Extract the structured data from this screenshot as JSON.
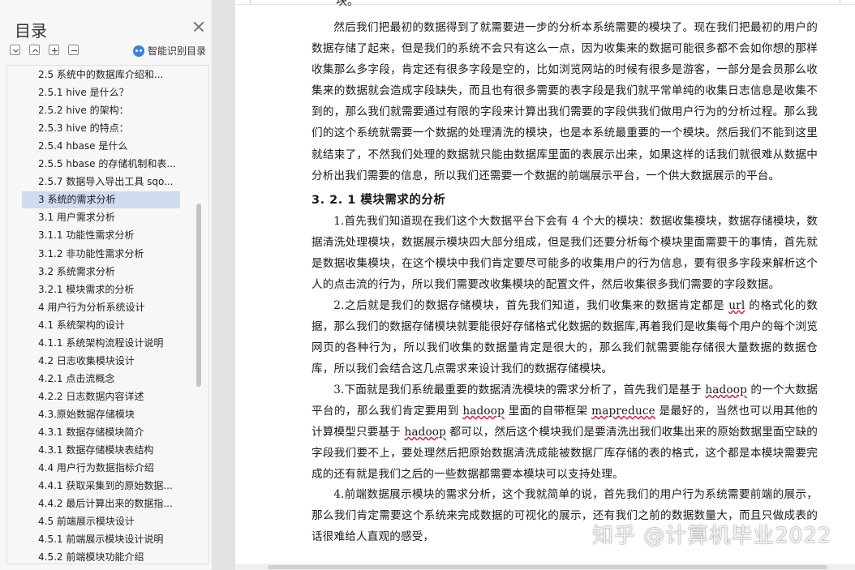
{
  "toc": {
    "title": "目录",
    "smart_toc_label": "智能识别目录",
    "items": [
      {
        "label": "2.5  系统中的数据库介绍和..."
      },
      {
        "label": "2.5.1 hive 是什么？"
      },
      {
        "label": "2.5.2 hive 的架构："
      },
      {
        "label": "2.5.3 hive 的特点："
      },
      {
        "label": "2.5.4 hbase 是什么"
      },
      {
        "label": "2.5.5 hbase 的存储机制和表..."
      },
      {
        "label": "2.5.7  数据导入导出工具 sqo..."
      },
      {
        "label": "3  系统的需求分析"
      },
      {
        "label": "3.1  用户需求分析"
      },
      {
        "label": "3.1.1  功能性需求分析"
      },
      {
        "label": "3.1.2  非功能性需求分析"
      },
      {
        "label": "3.2  系统需求分析"
      },
      {
        "label": "3.2.1  模块需求的分析"
      },
      {
        "label": "4 用户行为分析系统设计"
      },
      {
        "label": "4.1  系统架构的设计"
      },
      {
        "label": "4.1.1   系统架构流程设计说明"
      },
      {
        "label": "4.2  日志收集模块设计"
      },
      {
        "label": "4.2.1  点击流概念"
      },
      {
        "label": "4.2.2  日志数据内容详述"
      },
      {
        "label": "4.3.原始数据存储模块"
      },
      {
        "label": "4.3.1 数据存储模块简介"
      },
      {
        "label": "4.3.1  数据存储模块表结构"
      },
      {
        "label": "4.4  用户行为数据指标介绍"
      },
      {
        "label": "4.4.1  获取采集到的原始数据..."
      },
      {
        "label": "4.4.2  最后计算出来的数据指..."
      },
      {
        "label": "4.5  前端展示模块设计"
      },
      {
        "label": "4.5.1  前端展示模块设计说明"
      },
      {
        "label": "4.5.2  前端模块功能介绍"
      }
    ],
    "active_index": 7
  },
  "document": {
    "top_stub": "块。",
    "para1": "然后我们把最初的数据得到了就需要进一步的分析本系统需要的模块了。现在我们把最初的用户的数据存储了起来，但是我们的系统不会只有这么一点，因为收集来的数据可能很多都不会如你想的那样收集那么多字段，肯定还有很多字段是空的，比如浏览网站的时候有很多是游客，一部分是会员那么收集来的数据就会造成字段缺失，而且也有很多需要的表字段是我们就平常单纯的收集日志信息是收集不到的，那么我们就需要通过有限的字段来计算出我们需要的字段供我们做用户行为的分析过程。那么我们的这个系统就需要一个数据的处理清洗的模块，也是本系统最重要的一个模块。然后我们不能到这里就结束了，不然我们处理的数据就只能由数据库里面的表展示出来，如果这样的话我们就很难从数据中分析出我们需要的信息，所以我们还需要一个数据的前端展示平台，一个供大数据展示的平台。",
    "heading": "3. 2. 1  模块需求的分析",
    "para2": "1.首先我们知道现在我们这个大数据平台下会有 4 个大的模块：数据收集模块，数据存储模块，数据清洗处理模块，数据展示模块四大部分组成，但是我们还要分析每个模块里面需要干的事情，首先就是数据收集模块，在这个模块中我们肯定要尽可能多的收集用户的行为信息，要有很多字段来解析这个人的点击流的行为，所以我们需要改收集模块的配置文件，然后收集很多我们需要的字段数据。",
    "para3_a": "2.之后就是我们的数据存储模块，首先我们知道，我们收集来的数据肯定都是 ",
    "para3_u": "url",
    "para3_b": " 的格式化的数据，那么我们的数据存储模块就要能很好存储格式化数据的数据库,再着我们是收集每个用户的每个浏览网页的各种行为，所以我们收集的数据量肯定是很大的，那么我们就需要能存储很大量数据的数据仓库，所以我们会结合这几点需求来设计我们的数据存储模块。",
    "para4_a": "3.下面就是我们系统最重要的数据清洗模块的需求分析了，首先我们是基于 ",
    "para4_u1": "hadoop",
    "para4_b": " 的一个大数据平台的，那么我们肯定要用到 ",
    "para4_u2": "hadoop",
    "para4_c": " 里面的自带框架 ",
    "para4_u3": "mapreduce",
    "para4_d": " 是最好的，当然也可以用其他的计算模型只要基于 ",
    "para4_u4": "hadoop",
    "para4_e": " 都可以，然后这个模块我们是要清洗出我们收集出来的原始数据里面空缺的字段我们要不上，要处理然后把原始数据清洗成能被数据厂库存储的表的格式，这个都是本模块需要完成的还有就是我们之后的一些数据都需要本模块可以支持处理。",
    "para5": "4.前端数据展示模块的需求分析，这个我就简单的说，首先我们的用户行为系统需要前端的展示，那么我们肯定需要这个系统来完成数据的可视化的展示，还有我们之前的数据数量大，而且只做成表的话很难给人直观的感受，",
    "watermark": "知乎 @计算机毕业2022"
  }
}
